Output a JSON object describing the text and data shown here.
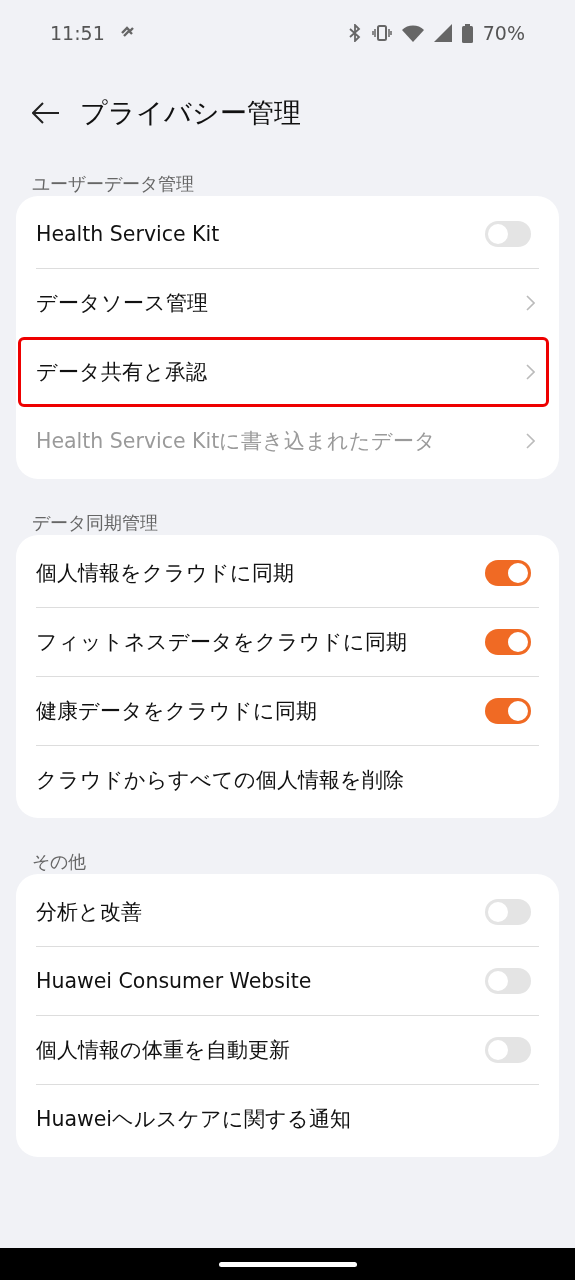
{
  "status_bar": {
    "time": "11:51",
    "battery": "70%"
  },
  "header": {
    "title": "プライバシー管理"
  },
  "sections": [
    {
      "title": "ユーザーデータ管理",
      "items": [
        {
          "kind": "toggle",
          "label": "Health Service Kit",
          "on": false,
          "disabled": false,
          "highlighted": false
        },
        {
          "kind": "link",
          "label": "データソース管理",
          "disabled": false,
          "highlighted": false
        },
        {
          "kind": "link",
          "label": "データ共有と承認",
          "disabled": false,
          "highlighted": true
        },
        {
          "kind": "link",
          "label": "Health Service Kitに書き込まれたデータ",
          "disabled": true,
          "highlighted": false
        }
      ]
    },
    {
      "title": "データ同期管理",
      "items": [
        {
          "kind": "toggle",
          "label": "個人情報をクラウドに同期",
          "on": true,
          "disabled": false,
          "highlighted": false
        },
        {
          "kind": "toggle",
          "label": "フィットネスデータをクラウドに同期",
          "on": true,
          "disabled": false,
          "highlighted": false
        },
        {
          "kind": "toggle",
          "label": "健康データをクラウドに同期",
          "on": true,
          "disabled": false,
          "highlighted": false
        },
        {
          "kind": "action",
          "label": "クラウドからすべての個人情報を削除",
          "disabled": false,
          "highlighted": false
        }
      ]
    },
    {
      "title": "その他",
      "items": [
        {
          "kind": "toggle",
          "label": "分析と改善",
          "on": false,
          "disabled": false,
          "highlighted": false
        },
        {
          "kind": "toggle",
          "label": "Huawei Consumer Website",
          "on": false,
          "disabled": false,
          "highlighted": false
        },
        {
          "kind": "toggle",
          "label": "個人情報の体重を自動更新",
          "on": false,
          "disabled": false,
          "highlighted": false
        },
        {
          "kind": "action",
          "label": "Huaweiヘルスケアに関する通知",
          "disabled": false,
          "highlighted": false
        }
      ]
    }
  ]
}
